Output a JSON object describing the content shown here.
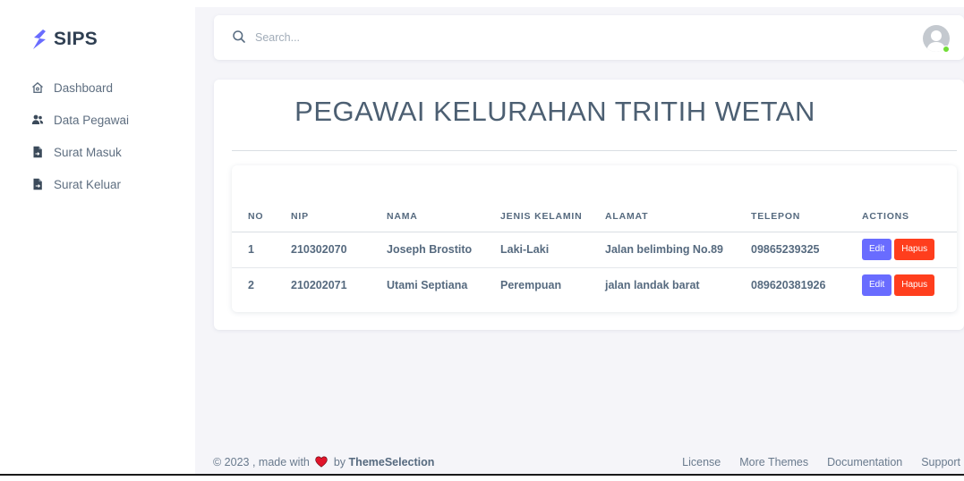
{
  "brand": {
    "name": "SIPS",
    "accent_color": "#696cff"
  },
  "sidebar": {
    "items": [
      {
        "label": "Dashboard",
        "icon": "home-icon"
      },
      {
        "label": "Data Pegawai",
        "icon": "users-icon"
      },
      {
        "label": "Surat Masuk",
        "icon": "file-import-icon"
      },
      {
        "label": "Surat Keluar",
        "icon": "file-export-icon"
      }
    ]
  },
  "navbar": {
    "search_placeholder": "Search...",
    "search_icon": "search-icon",
    "avatar_icon": "user-avatar-icon"
  },
  "page": {
    "title": "PEGAWAI KELURAHAN TRITIH WETAN"
  },
  "table": {
    "headers": [
      "NO",
      "NIP",
      "NAMA",
      "JENIS KELAMIN",
      "ALAMAT",
      "TELEPON",
      "ACTIONS"
    ],
    "rows": [
      {
        "no": "1",
        "nip": "210302070",
        "nama": "Joseph Brostito",
        "jenis_kelamin": "Laki-Laki",
        "alamat": "Jalan belimbing No.89",
        "telepon": "09865239325"
      },
      {
        "no": "2",
        "nip": "210202071",
        "nama": "Utami Septiana",
        "jenis_kelamin": "Perempuan",
        "alamat": "jalan landak barat",
        "telepon": "089620381926"
      }
    ],
    "edit_label": "Edit",
    "delete_label": "Hapus",
    "edit_color": "#696cff",
    "delete_color": "#ff3e1d"
  },
  "footer": {
    "copyright": "© 2023 , made with",
    "by": "by",
    "brand": "ThemeSelection",
    "heart_icon": "heart-icon",
    "links": [
      "License",
      "More Themes",
      "Documentation",
      "Support"
    ]
  }
}
